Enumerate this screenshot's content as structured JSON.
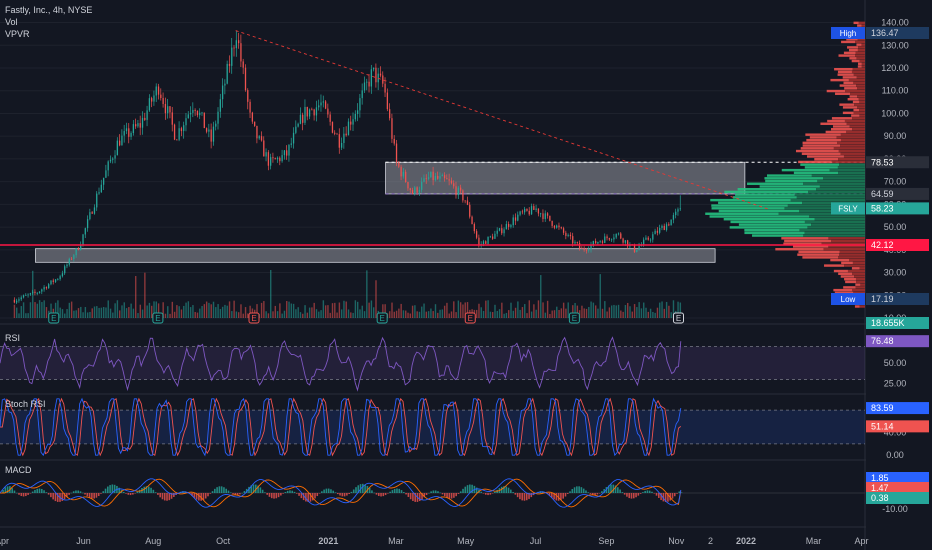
{
  "header": {
    "symbol_line": "Fastly, Inc., 4h, NYSE",
    "vol_label": "Vol",
    "vpvr_label": "VPVR"
  },
  "panes": {
    "rsi_label": "RSI",
    "stoch_label": "Stoch RSI",
    "macd_label": "MACD"
  },
  "colors": {
    "background": "#131722",
    "up": "#26a69a",
    "down": "#ef5350",
    "support_line": "#ff1744",
    "trend_line": "#e53935",
    "rsi": "#7e57c2",
    "stoch_k": "#2962ff",
    "stoch_d": "#ef5350",
    "macd": "#2962ff",
    "signal": "#ff6d00",
    "zone_fill": "#9598a1"
  },
  "chart_data": {
    "type": "candlestick",
    "price_axis": {
      "ticks": [
        10,
        20,
        30,
        40,
        50,
        60,
        70,
        80,
        90,
        100,
        110,
        120,
        130,
        140
      ],
      "range": [
        10,
        142
      ],
      "labels": [
        {
          "name": "High",
          "value": 136.47,
          "text": "136.47"
        },
        {
          "name": "Resistance top",
          "value": 78.53,
          "text": "78.53"
        },
        {
          "name": "Resistance bottom",
          "value": 64.59,
          "text": "64.59"
        },
        {
          "name": "FSLY",
          "value": 58.23,
          "text": "58.23"
        },
        {
          "name": "Support",
          "value": 42.12,
          "text": "42.12"
        },
        {
          "name": "Low",
          "value": 17.19,
          "text": "17.19"
        },
        {
          "name": "Vol",
          "value": 10,
          "text": "18.655K"
        }
      ]
    },
    "time_axis": [
      "Apr",
      "Jun",
      "Aug",
      "Oct",
      "2021",
      "Mar",
      "May",
      "Jul",
      "Sep",
      "Nov",
      "2",
      "2022",
      "Mar",
      "Apr"
    ],
    "price_path": [
      [
        "2020-04-01",
        18
      ],
      [
        "2020-04-20",
        21
      ],
      [
        "2020-05-10",
        28
      ],
      [
        "2020-05-28",
        42
      ],
      [
        "2020-06-15",
        68
      ],
      [
        "2020-07-01",
        88
      ],
      [
        "2020-07-20",
        95
      ],
      [
        "2020-08-05",
        112
      ],
      [
        "2020-08-20",
        90
      ],
      [
        "2020-09-05",
        105
      ],
      [
        "2020-09-20",
        88
      ],
      [
        "2020-10-05",
        120
      ],
      [
        "2020-10-12",
        136
      ],
      [
        "2020-10-25",
        95
      ],
      [
        "2020-11-10",
        78
      ],
      [
        "2020-11-25",
        82
      ],
      [
        "2020-12-10",
        100
      ],
      [
        "2020-12-25",
        104
      ],
      [
        "2021-01-10",
        88
      ],
      [
        "2021-01-25",
        102
      ],
      [
        "2021-02-08",
        118
      ],
      [
        "2021-02-18",
        112
      ],
      [
        "2021-03-01",
        78
      ],
      [
        "2021-03-15",
        65
      ],
      [
        "2021-03-30",
        72
      ],
      [
        "2021-04-15",
        70
      ],
      [
        "2021-04-30",
        62
      ],
      [
        "2021-05-12",
        42
      ],
      [
        "2021-05-30",
        48
      ],
      [
        "2021-06-15",
        55
      ],
      [
        "2021-07-01",
        58
      ],
      [
        "2021-07-15",
        52
      ],
      [
        "2021-07-30",
        45
      ],
      [
        "2021-08-10",
        40
      ],
      [
        "2021-08-25",
        44
      ],
      [
        "2021-09-10",
        47
      ],
      [
        "2021-09-25",
        40
      ],
      [
        "2021-10-10",
        46
      ],
      [
        "2021-10-25",
        52
      ],
      [
        "2021-11-05",
        58.23
      ]
    ],
    "spikes": [
      {
        "date": "2020-10-12",
        "high": 136.47
      },
      {
        "date": "2021-02-12",
        "high": 122
      },
      {
        "date": "2021-11-04",
        "high": 64
      }
    ],
    "zones": [
      {
        "name": "resistance",
        "top": 78.53,
        "bottom": 64.59,
        "from": "2021-02-20",
        "to": "2021-12-31"
      },
      {
        "name": "support",
        "top": 40.5,
        "bottom": 34.5,
        "from": "2020-04-20",
        "to": "2021-12-05"
      }
    ],
    "support_line": 42.12,
    "trend_line": [
      [
        "2020-10-12",
        136.47
      ],
      [
        "2022-01-20",
        58
      ]
    ],
    "earnings_markers": [
      {
        "date": "2020-05-06",
        "label": "E",
        "type": "up"
      },
      {
        "date": "2020-08-05",
        "label": "E",
        "type": "up"
      },
      {
        "date": "2020-10-28",
        "label": "E",
        "type": "down"
      },
      {
        "date": "2021-02-17",
        "label": "E",
        "type": "up"
      },
      {
        "date": "2021-05-05",
        "label": "E",
        "type": "down"
      },
      {
        "date": "2021-08-04",
        "label": "E",
        "type": "up"
      },
      {
        "date": "2021-11-03",
        "label": "E",
        "type": "neutral"
      }
    ],
    "volume_profile": {
      "green_value_area": [
        46,
        78.5
      ],
      "peak_price": 58
    },
    "rsi": {
      "ticks": [
        25.0,
        50.0,
        75.0
      ],
      "tick_labels": [
        "25.00",
        "50.00",
        "75.00"
      ],
      "levels": [
        30,
        70
      ],
      "last": 76.48,
      "last_text": "76.48"
    },
    "stoch_rsi": {
      "ticks": [
        0.0,
        40.0,
        80.0
      ],
      "tick_labels": [
        "0.00",
        "40.00",
        "80.00"
      ],
      "levels": [
        20,
        80
      ],
      "k_last": 83.59,
      "k_text": "83.59",
      "d_last": 51.14,
      "d_text": "51.14"
    },
    "macd": {
      "ticks": [
        -10.0,
        10.0
      ],
      "tick_labels": [
        "-10.00",
        "10.00"
      ],
      "macd_last": 1.85,
      "macd_text": "1.85",
      "signal_last": 1.47,
      "signal_text": "1.47",
      "hist_last": 0.38,
      "hist_text": "0.38"
    }
  }
}
